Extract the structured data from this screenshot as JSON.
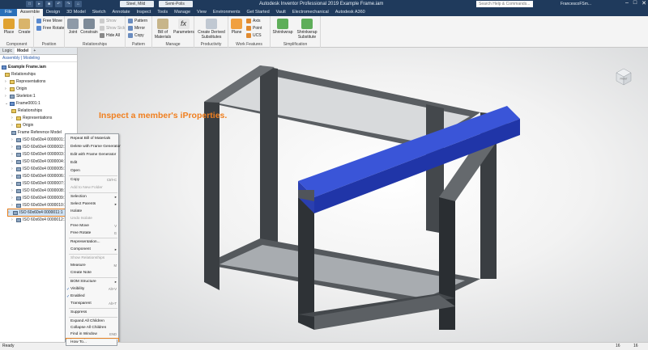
{
  "titlebar": {
    "app_title": "Autodesk Inventor Professional 2019   Example Frame.iam",
    "material_combo": "Steel, Mild",
    "appearance_combo": "Semi-Polis",
    "search_placeholder": "Search Help & Commands...",
    "user": "FrancescoFSm..."
  },
  "tabs": [
    "File",
    "Assemble",
    "Design",
    "3D Model",
    "Sketch",
    "Annotate",
    "Inspect",
    "Tools",
    "Manage",
    "View",
    "Environments",
    "Get Started",
    "Vault",
    "Electromechanical",
    "Autodesk A360"
  ],
  "ribbon": {
    "groups": {
      "component": "Component",
      "position": "Position",
      "relationships": "Relationships",
      "pattern": "Pattern",
      "manage": "Manage",
      "productivity": "Productivity",
      "work_features": "Work Features",
      "simplification": "Simplification"
    },
    "place": "Place",
    "create": "Create",
    "free_move": "Free Move",
    "free_rotate": "Free Rotate",
    "joint": "Joint",
    "constrain": "Constrain",
    "show": "Show",
    "show_sick": "Show Sick",
    "hide_all": "Hide All",
    "pattern": "Pattern",
    "mirror": "Mirror",
    "copy": "Copy",
    "bill_of_materials": "Bill of Materials",
    "parameters": "Parameters",
    "create_derived": "Create Derived Substitutes",
    "plane": "Plane",
    "axis": "Axis",
    "point": "Point",
    "ucs": "UCS",
    "shrinkwrap": "Shrinkwrap",
    "shrinkwrap_sub": "Shrinkwrap Substitute"
  },
  "browser": {
    "tabs": [
      "Logic",
      "Model"
    ],
    "subtabs": "Assembly | Modeling",
    "items": [
      "Example Frame.iam",
      "Relationships",
      "Representations",
      "Origin",
      "Skeleton:1",
      "Frame0001:1",
      "Relationships",
      "Representations",
      "Origin",
      "Frame Reference Model",
      "ISO 60x60x4 0000001:1",
      "ISO 60x60x4 0000002:1",
      "ISO 60x60x4 0000003:1",
      "ISO 60x60x4 0000004:1",
      "ISO 60x60x4 0000005:1",
      "ISO 60x60x4 0000006:1",
      "ISO 60x60x4 0000007:1",
      "ISO 60x60x4 0000008:1",
      "ISO 60x60x4 0000009:1",
      "ISO 60x60x4 0000010:1",
      "ISO 60x60x4 0000011:1",
      "ISO 60x60x4 0000012:1"
    ]
  },
  "annotation": "Inspect a member's iProperties.",
  "viewcube_label": "FRONT",
  "context_menu": [
    {
      "label": "Repeat Bill of Materials",
      "shortcut": ""
    },
    {
      "label": "Delete with Frame Generator",
      "shortcut": ""
    },
    {
      "label": "Edit with Frame Generator",
      "shortcut": ""
    },
    {
      "label": "Edit",
      "shortcut": ""
    },
    {
      "label": "Open",
      "shortcut": ""
    },
    {
      "label": "Copy",
      "shortcut": "Ctrl+C"
    },
    {
      "label": "Add to New Folder",
      "shortcut": ""
    },
    {
      "label": "Selection",
      "shortcut": ""
    },
    {
      "label": "Select Parents",
      "shortcut": ""
    },
    {
      "label": "Isolate",
      "shortcut": ""
    },
    {
      "label": "Undo Isolate",
      "shortcut": ""
    },
    {
      "label": "Free Move",
      "shortcut": "V"
    },
    {
      "label": "Free Rotate",
      "shortcut": "G"
    },
    {
      "label": "Representation...",
      "shortcut": ""
    },
    {
      "label": "Component",
      "shortcut": ""
    },
    {
      "label": "Show Relationships",
      "shortcut": ""
    },
    {
      "label": "Measure",
      "shortcut": "M"
    },
    {
      "label": "Create Note",
      "shortcut": ""
    },
    {
      "label": "BOM Structure",
      "shortcut": ""
    },
    {
      "label": "Visibility",
      "shortcut": "Alt+V"
    },
    {
      "label": "Enabled",
      "shortcut": ""
    },
    {
      "label": "Transparent",
      "shortcut": "Alt+T"
    },
    {
      "label": "Suppress",
      "shortcut": ""
    },
    {
      "label": "Expand All Children",
      "shortcut": ""
    },
    {
      "label": "Collapse All Children",
      "shortcut": ""
    },
    {
      "label": "Find in Window",
      "shortcut": "END"
    },
    {
      "label": "iProperties...",
      "shortcut": ""
    },
    {
      "label": "How To...",
      "shortcut": ""
    }
  ],
  "status": {
    "ready": "Ready",
    "num1": "16",
    "num2": "16"
  },
  "colors": {
    "highlight": "#e8801e",
    "selected_member": "#2b46c8",
    "frame": "#4a4e52",
    "title_bg": "#1f3a5c"
  }
}
